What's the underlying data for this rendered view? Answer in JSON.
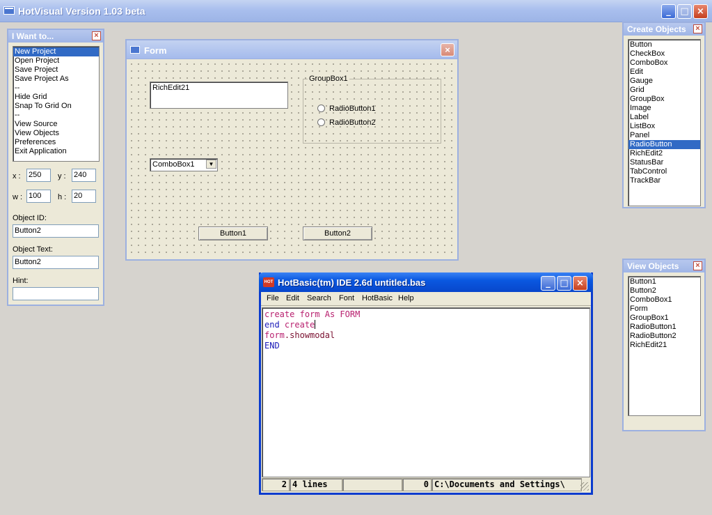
{
  "app": {
    "title": "HotVisual Version 1.03 beta"
  },
  "i_want_panel": {
    "title": "I Want to...",
    "close": "×",
    "items": [
      "New Project",
      "Open Project",
      "Save Project",
      "Save Project As",
      "--",
      "Hide Grid",
      "Snap To Grid On",
      "--",
      "View Source",
      "View Objects",
      "Preferences",
      "Exit Application"
    ],
    "selected": "New Project",
    "x_label": "x :",
    "x_value": "250",
    "y_label": "y :",
    "y_value": "240",
    "w_label": "w :",
    "w_value": "100",
    "h_label": "h :",
    "h_value": "20",
    "object_id_label": "Object ID:",
    "object_id_value": "Button2",
    "object_text_label": "Object Text:",
    "object_text_value": "Button2",
    "hint_label": "Hint:",
    "hint_value": ""
  },
  "form_window": {
    "title": "Form",
    "close": "×",
    "richedit_text": "RichEdit21",
    "groupbox_caption": "GroupBox1",
    "radio1": "RadioButton1",
    "radio2": "RadioButton2",
    "combo_text": "ComboBox1",
    "button1": "Button1",
    "button2": "Button2"
  },
  "create_objects_panel": {
    "title": "Create Objects",
    "close": "×",
    "items": [
      "Button",
      "CheckBox",
      "ComboBox",
      "Edit",
      "Gauge",
      "Grid",
      "GroupBox",
      "Image",
      "Label",
      "ListBox",
      "Panel",
      "RadioButton",
      "RichEdit2",
      "StatusBar",
      "TabControl",
      "TrackBar"
    ],
    "selected": "RadioButton"
  },
  "view_objects_panel": {
    "title": "View Objects",
    "close": "×",
    "items": [
      "Button1",
      "Button2",
      "ComboBox1",
      "Form",
      "GroupBox1",
      "RadioButton1",
      "RadioButton2",
      "RichEdit21"
    ]
  },
  "ide": {
    "title": "HotBasic(tm) IDE 2.6d untitled.bas",
    "icon_text": "HOT",
    "menu": [
      "File",
      "Edit",
      "Search",
      "Font",
      "HotBasic",
      "Help"
    ],
    "code": {
      "l1_a": "create",
      "l1_b": "form",
      "l1_c": "As",
      "l1_d": "FORM",
      "l2_a": "end",
      "l2_b": "create",
      "l3_a": "form",
      "l3_b": ".showmodal",
      "l4_a": "END"
    },
    "status": {
      "line": "2",
      "lines": "4 lines",
      "empty": "",
      "col": "0",
      "path": "C:\\Documents and Settings\\"
    }
  },
  "colors": {
    "selection": "#316ac5",
    "ide_titlebar": "#0a58e0",
    "keyword_magenta": "#b8206f",
    "keyword_blue": "#1a1ab8"
  }
}
